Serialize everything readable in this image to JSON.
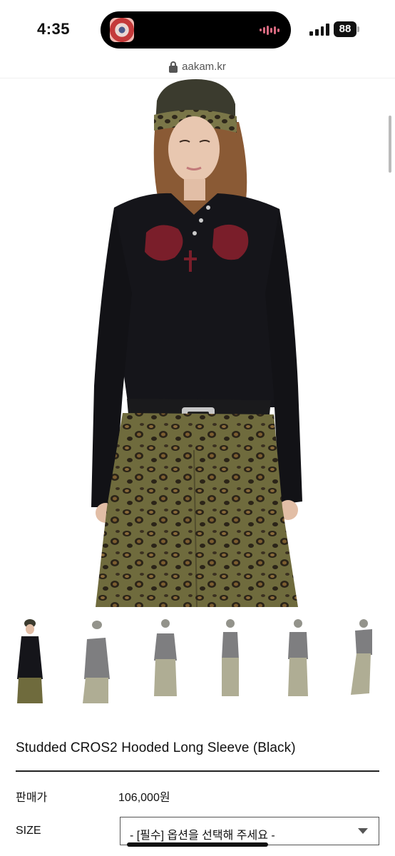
{
  "status_bar": {
    "time": "4:35",
    "battery": "88"
  },
  "browser": {
    "url": "aakam.kr",
    "icons": {
      "lock": "lock-icon"
    }
  },
  "product": {
    "title": "Studded CROS2 Hooded Long Sleeve (Black)",
    "price_label": "판매가",
    "price_value": "106,000원",
    "size_label": "SIZE",
    "size_select_value": "- [필수] 옵션을 선택해 주세요 -",
    "thumbnail_count": 6,
    "selected_thumbnail": 1
  },
  "colors": {
    "shirt": "#15151a",
    "embroidery": "#7a1e2a",
    "leopard_base": "#6d6a3c",
    "divider": "#222222"
  }
}
